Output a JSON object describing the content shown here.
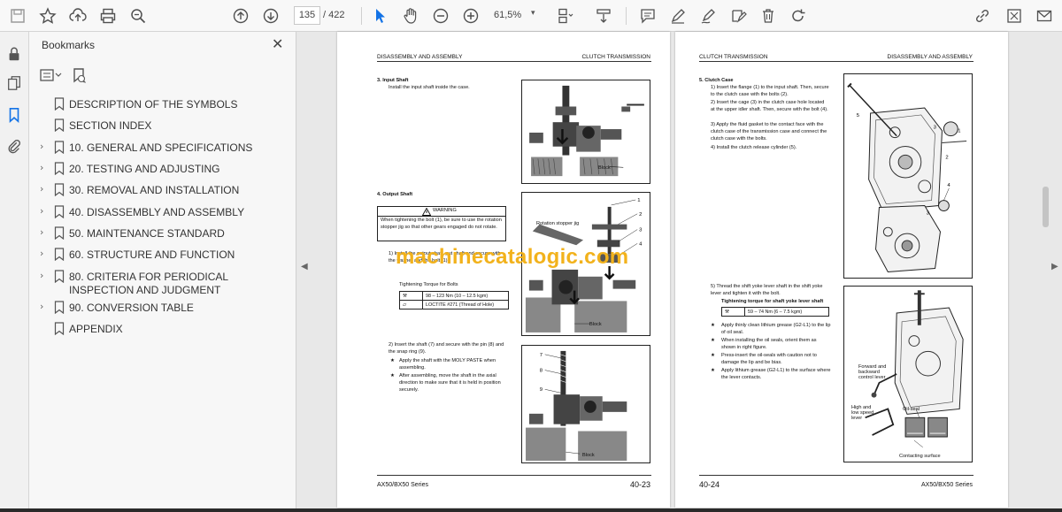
{
  "toolbar": {
    "page_current": "135",
    "page_total": "/ 422",
    "zoom": "61,5%"
  },
  "bookmarks_panel": {
    "title": "Bookmarks",
    "items": [
      {
        "label": "DESCRIPTION OF THE SYMBOLS",
        "expandable": false
      },
      {
        "label": "SECTION INDEX",
        "expandable": false
      },
      {
        "label": "10. GENERAL AND SPECIFICATIONS",
        "expandable": true
      },
      {
        "label": "20. TESTING AND ADJUSTING",
        "expandable": true
      },
      {
        "label": "30. REMOVAL AND INSTALLATION",
        "expandable": true
      },
      {
        "label": "40. DISASSEMBLY AND ASSEMBLY",
        "expandable": true
      },
      {
        "label": "50. MAINTENANCE STANDARD",
        "expandable": true
      },
      {
        "label": "60. STRUCTURE AND FUNCTION",
        "expandable": true
      },
      {
        "label": "80. CRITERIA FOR PERIODICAL INSPECTION AND JUDGMENT",
        "expandable": true
      },
      {
        "label": "90. CONVERSION TABLE",
        "expandable": true
      },
      {
        "label": "APPENDIX",
        "expandable": false
      }
    ]
  },
  "left_page": {
    "header_left": "DISASSEMBLY AND ASSEMBLY",
    "header_right": "CLUTCH TRANSMISSION",
    "s3_title": "3.    Input Shaft",
    "s3_text": "Install the input shaft inside the case.",
    "fig1_label": "Block",
    "s4_title": "4.    Output Shaft",
    "warning_title": "WARNING",
    "warning_text": "When tightening the bolt (1), be sure to use the rotation stopper jig so that other gears engaged do not rotate.",
    "step1_text": "1)   Install the output shaft, put shaft and secure with the washer and the bolt (1).",
    "torque_label": "Tightening Torque for Bolts",
    "torque_value": "98 – 123 Nm (10 – 12.5 kgm)",
    "loctite_value": "LOCTITE #271 (Thread of Hole)",
    "fig2_label1": "Rotation stopper jig",
    "fig2_label2": "Block",
    "step2_text": "2)   Insert the shaft (7) and secure with the pin (8) and the snap ring (9).",
    "note1": "Apply the shaft with the MOLY PASTE when assembling.",
    "note2": "After assembling, move the shaft in the axial direction to make sure that it is held in position securely.",
    "fig3_label": "Block",
    "footer_model": "AX50/BX50 Series",
    "page_number": "40-23"
  },
  "right_page": {
    "header_left": "CLUTCH TRANSMISSION",
    "header_right": "DISASSEMBLY AND ASSEMBLY",
    "s5_title": "5.    Clutch Case",
    "s5_steps": [
      "1)   Insert the flange (1) to the input shaft. Then, secure to the clutch case with the bolts (2).",
      "2)   Insert the cage (3) in the clutch case hole located at the upper idler shaft. Then, secure with the bolt (4).",
      "3)   Apply the fluid gasket to the contact face with the clutch case of the transmission case and connect the clutch case with the bolts.",
      "4)   Install the clutch release cylinder (5)."
    ],
    "step5_text": "5)   Thread the shift yoke lever shaft in the shift yoke lever and tighten it with the bolt.",
    "torque_label": "Tightening torque for shaft yoke lever shaft",
    "torque_value": "59 – 74 Nm (6 – 7.5 kgm)",
    "notes": [
      "Apply thinly clean lithium grease (G2-L1) to the lip of oil seal.",
      "When installing the oil seals, orient them as shown in right figure.",
      "Press-insert the oil-seals with caution not to damage the lip and be bias.",
      "Apply lithium grease (G2-L1) to the surface where the lever contacts."
    ],
    "fig2_labels": {
      "forward": "Forward and backward control lever",
      "highlow": "High and low speed lever",
      "oilseal": "Oil-seal",
      "contact": "Contacting surface"
    },
    "page_number": "40-24",
    "footer_model": "AX50/BX50 Series"
  },
  "watermark": "machinecatalogic.com"
}
